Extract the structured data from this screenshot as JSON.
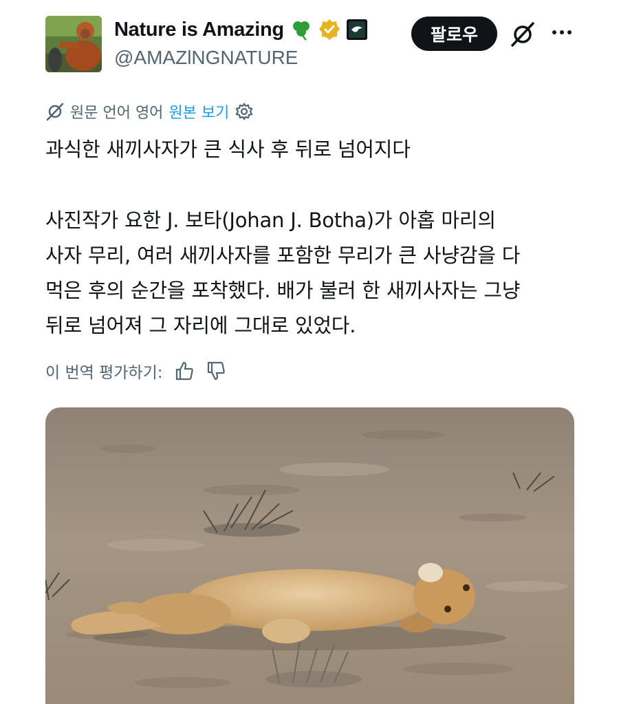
{
  "author": {
    "display_name": "Nature is Amazing",
    "handle": "@AMAZlNGNATURE",
    "shamrock": "☘️",
    "avatar_icon": "orangutan-avatar",
    "verified_badge_color": "#e6b422",
    "affiliate_badge_icon": "affiliate-badge-icon"
  },
  "actions": {
    "follow_label": "팔로우",
    "grok_icon": "grok-icon",
    "more_icon": "more-icon"
  },
  "translation": {
    "label": "원문 언어 영어",
    "show_original": "원본 보기"
  },
  "tweet": {
    "title": "과식한 새끼사자가 큰 식사 후 뒤로 넘어지다",
    "body_lines": [
      "사진작가 요한 J. 보타(Johan J. Botha)가 아홉 마리의",
      "사자 무리, 여러 새끼사자를 포함한 무리가 큰 사냥감을 다",
      "먹은 후의 순간을 포착했다. 배가 불러 한 새끼사자는 그냥",
      "뒤로 넘어져 그 자리에 그대로 있었다."
    ]
  },
  "rating": {
    "label": "이 번역 평가하기:"
  },
  "media": {
    "image_icon": "lion-cub-photo"
  },
  "colors": {
    "primary_text": "#0f1419",
    "secondary_text": "#536471",
    "link": "#1d9bf0",
    "follow_bg": "#0f1419"
  }
}
